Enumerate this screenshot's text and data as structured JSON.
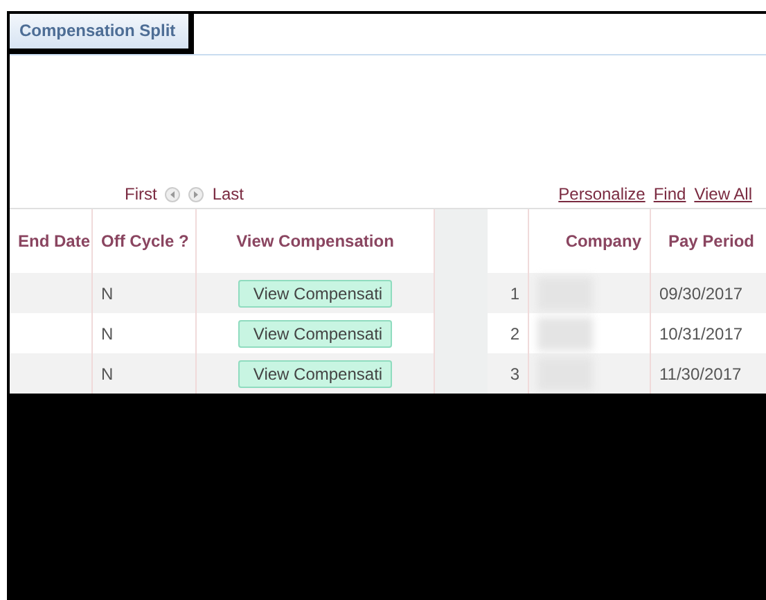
{
  "page_tab": {
    "label": "Compensation Split"
  },
  "grid_nav": {
    "first": "First",
    "last": "Last",
    "links": [
      "Personalize",
      "Find",
      "View All"
    ]
  },
  "left_grid": {
    "columns": [
      "End Date",
      "Off Cycle ?",
      "View Compensation"
    ],
    "rows": [
      {
        "off_cycle": "N",
        "button": "View Compensati"
      },
      {
        "off_cycle": "N",
        "button": "View Compensati"
      },
      {
        "off_cycle": "N",
        "button": "View Compensati"
      }
    ]
  },
  "right_grid": {
    "columns": [
      "Company",
      "Pay Period"
    ],
    "rows": [
      {
        "number": "1",
        "pay_period": "09/30/2017"
      },
      {
        "number": "2",
        "pay_period": "10/31/2017"
      },
      {
        "number": "3",
        "pay_period": "11/30/2017"
      }
    ]
  }
}
